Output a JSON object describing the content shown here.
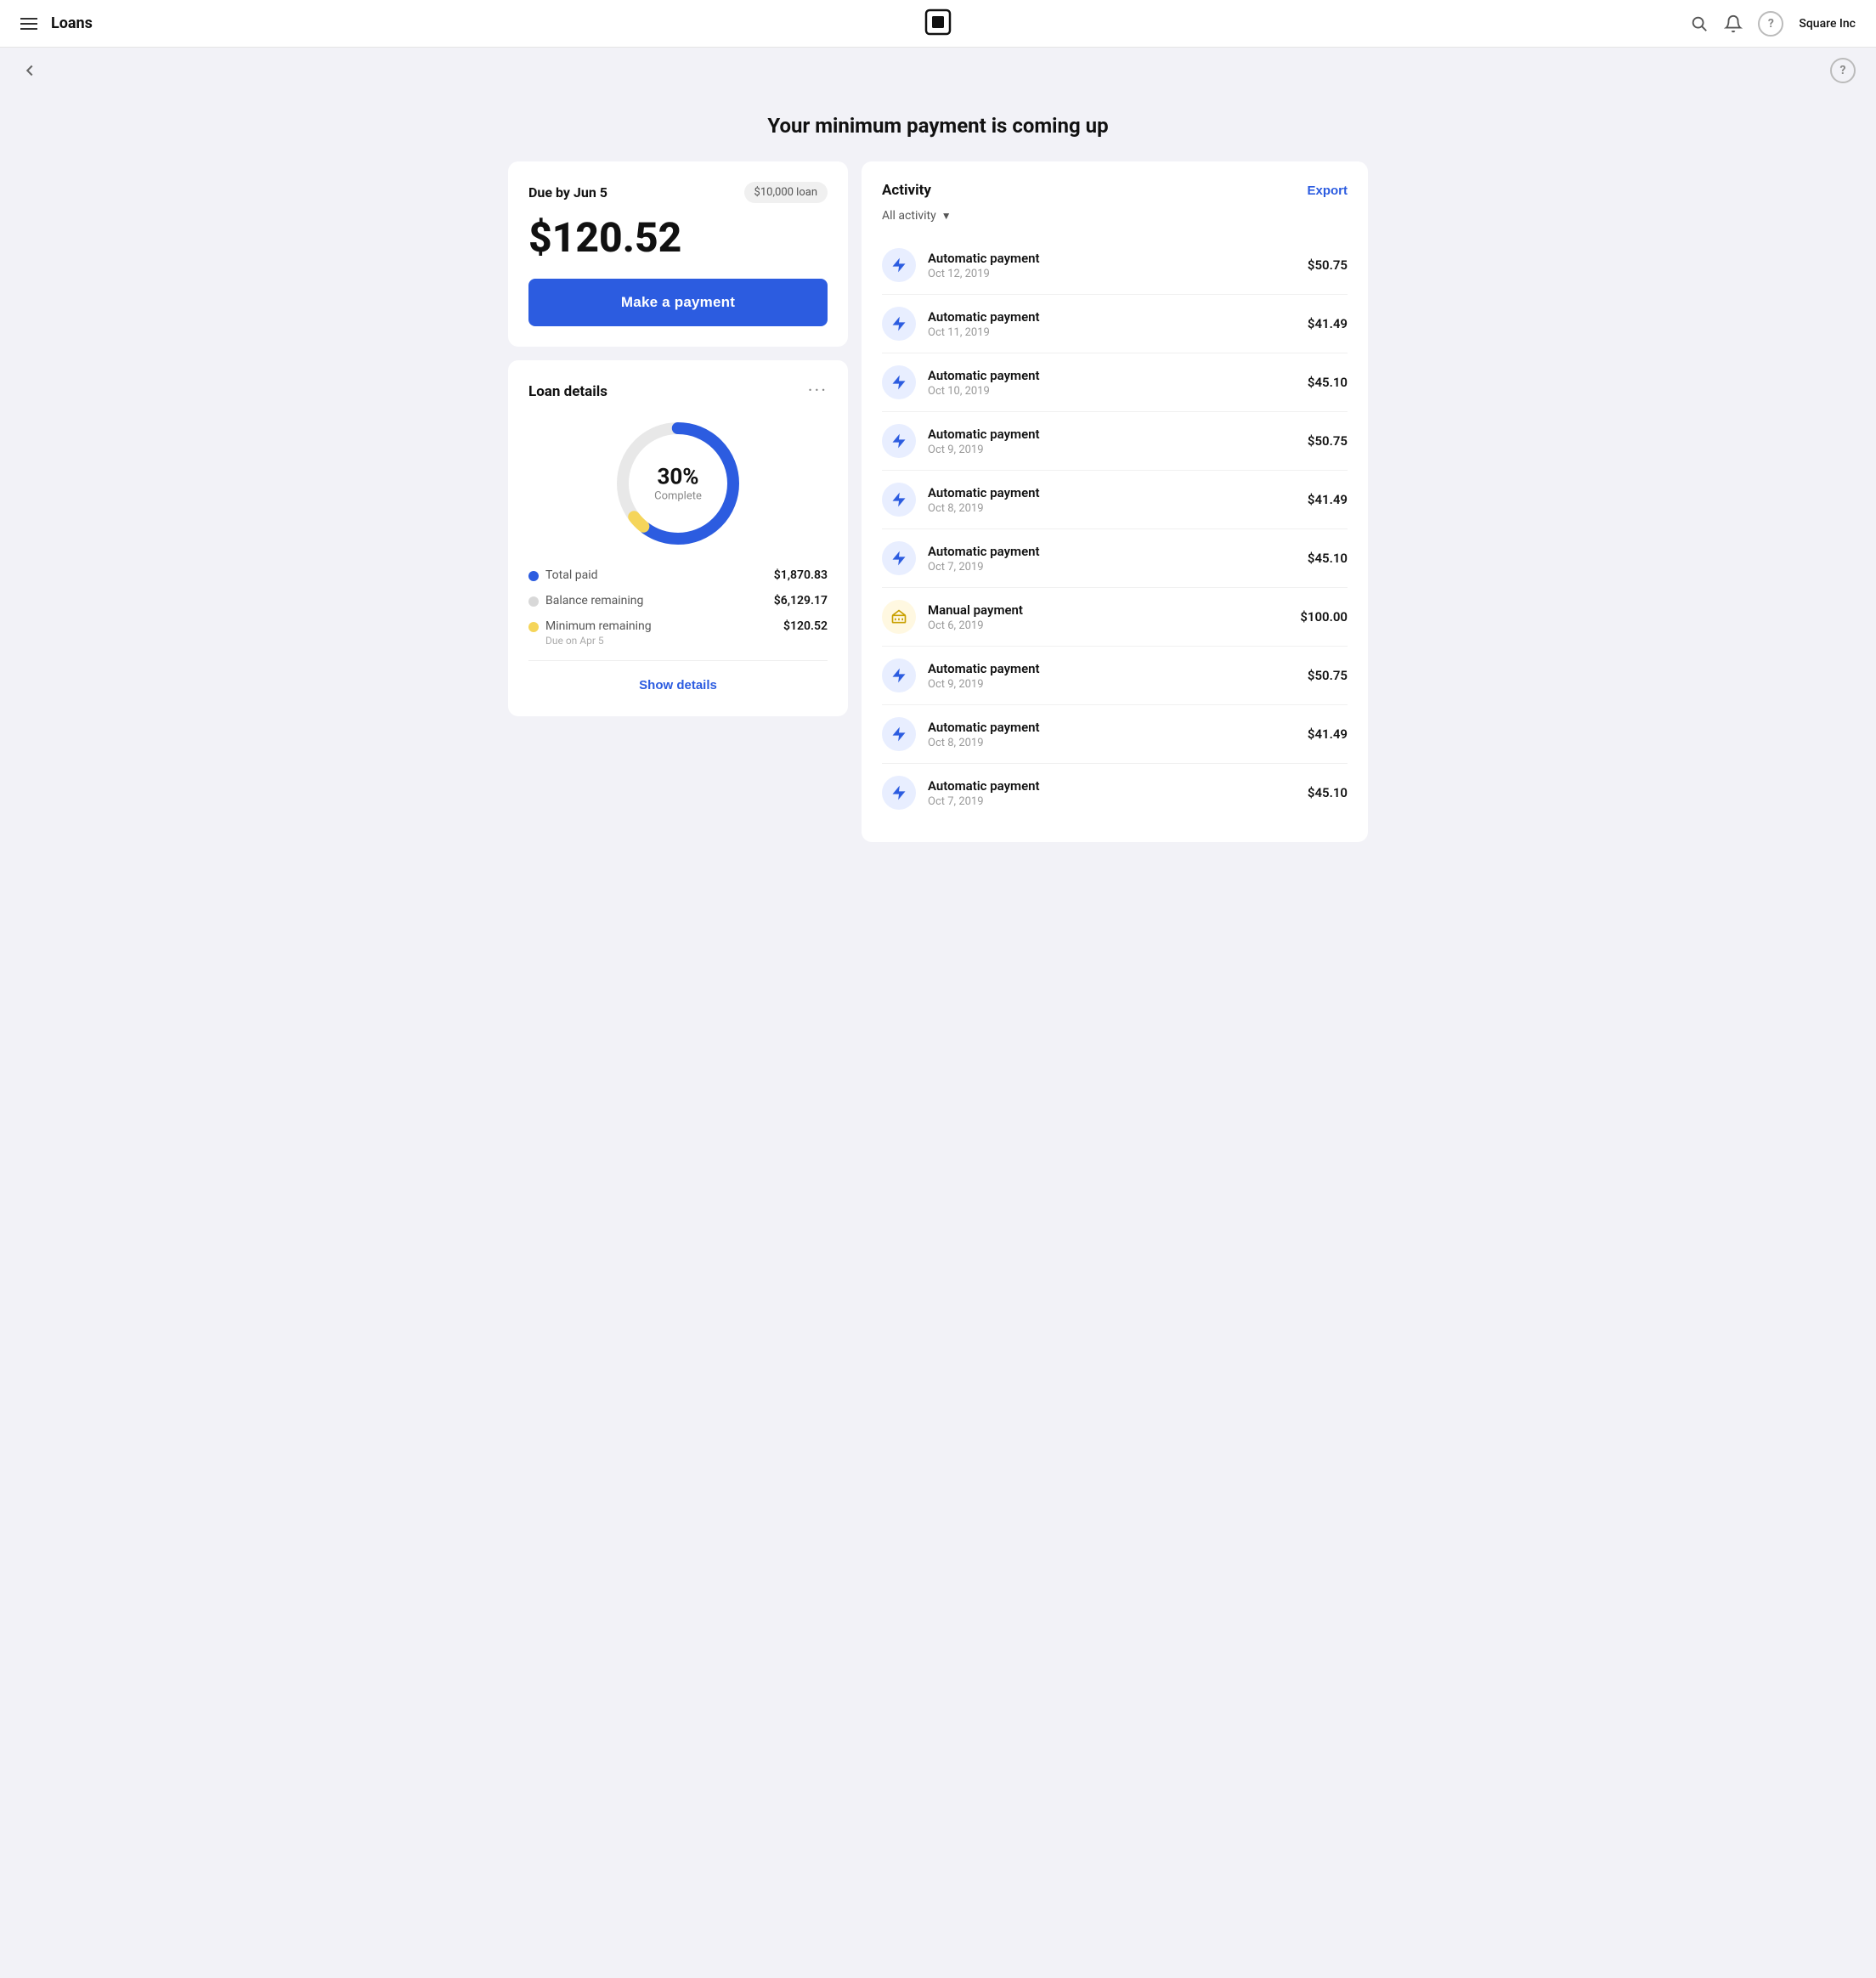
{
  "header": {
    "menu_label": "menu",
    "title": "Loans",
    "logo_alt": "Square logo",
    "user_label": "Square Inc",
    "search_label": "search",
    "notifications_label": "notifications",
    "help_label": "help"
  },
  "sub_header": {
    "back_label": "back",
    "help_label": "help"
  },
  "page": {
    "title": "Your minimum payment is coming up"
  },
  "payment_card": {
    "due_label": "Due by Jun 5",
    "loan_badge": "$10,000 loan",
    "amount": "$120.52",
    "button_label": "Make a payment"
  },
  "loan_details": {
    "title": "Loan details",
    "donut": {
      "percent": "30%",
      "label": "Complete"
    },
    "legend": [
      {
        "color": "#2c5ce0",
        "label": "Total paid",
        "value": "$1,870.83",
        "sub": null
      },
      {
        "color": "#e0e0e0",
        "label": "Balance remaining",
        "value": "$6,129.17",
        "sub": null
      },
      {
        "color": "#f5d55a",
        "label": "Minimum remaining",
        "value": "$120.52",
        "sub": "Due on Apr 5"
      }
    ],
    "show_details_label": "Show details"
  },
  "activity": {
    "title": "Activity",
    "export_label": "Export",
    "filter_label": "All activity",
    "items": [
      {
        "type": "auto",
        "name": "Automatic payment",
        "date": "Oct 12, 2019",
        "amount": "$50.75"
      },
      {
        "type": "auto",
        "name": "Automatic payment",
        "date": "Oct 11, 2019",
        "amount": "$41.49"
      },
      {
        "type": "auto",
        "name": "Automatic payment",
        "date": "Oct 10, 2019",
        "amount": "$45.10"
      },
      {
        "type": "auto",
        "name": "Automatic payment",
        "date": "Oct 9, 2019",
        "amount": "$50.75"
      },
      {
        "type": "auto",
        "name": "Automatic payment",
        "date": "Oct 8, 2019",
        "amount": "$41.49"
      },
      {
        "type": "auto",
        "name": "Automatic payment",
        "date": "Oct 7, 2019",
        "amount": "$45.10"
      },
      {
        "type": "bank",
        "name": "Manual payment",
        "date": "Oct 6, 2019",
        "amount": "$100.00"
      },
      {
        "type": "auto",
        "name": "Automatic payment",
        "date": "Oct 9, 2019",
        "amount": "$50.75"
      },
      {
        "type": "auto",
        "name": "Automatic payment",
        "date": "Oct 8, 2019",
        "amount": "$41.49"
      },
      {
        "type": "auto",
        "name": "Automatic payment",
        "date": "Oct 7, 2019",
        "amount": "$45.10"
      }
    ]
  },
  "donut_chart": {
    "total_circumference": 408.41,
    "blue_pct": 0.6,
    "yellow_pct": 0.04,
    "gray_pct": 0.36,
    "radius": 65,
    "stroke_width": 14
  }
}
